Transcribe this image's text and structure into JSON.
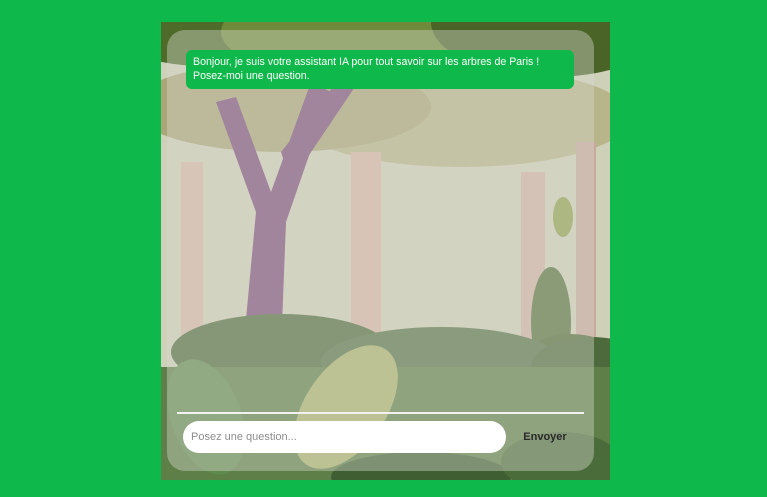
{
  "chat": {
    "messages": [
      {
        "sender": "assistant",
        "text": "Bonjour, je suis votre assistant IA pour tout savoir sur les arbres de Paris ! Posez-moi une question."
      }
    ]
  },
  "composer": {
    "placeholder": "Posez une question...",
    "send_label": "Envoyer"
  },
  "colors": {
    "page_background": "#0fb84a",
    "bubble_background": "#0fb84a",
    "bubble_text": "#ffffff"
  },
  "background": {
    "illustration": "forest-illustration"
  }
}
